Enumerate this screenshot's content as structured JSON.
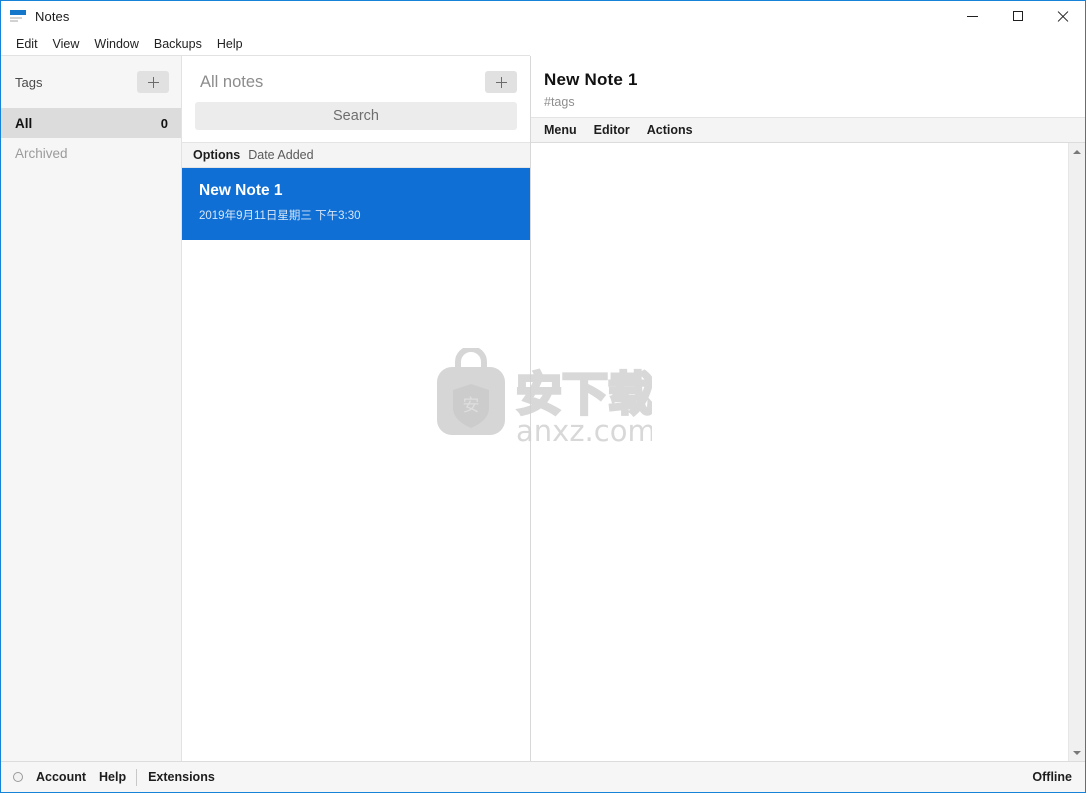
{
  "window": {
    "title": "Notes",
    "icon": "notes-app-icon",
    "controls": {
      "minimize": "minimize-icon",
      "maximize": "maximize-icon",
      "close": "close-icon"
    },
    "accent_color": "#1683d8"
  },
  "menubar": {
    "items": [
      {
        "label": "Edit"
      },
      {
        "label": "View"
      },
      {
        "label": "Window"
      },
      {
        "label": "Backups"
      },
      {
        "label": "Help"
      }
    ]
  },
  "sidebar": {
    "header_label": "Tags",
    "add_tag_icon": "plus-icon",
    "items": [
      {
        "label": "All",
        "count": "0",
        "selected": true
      },
      {
        "label": "Archived",
        "count": "",
        "selected": false
      }
    ]
  },
  "notelist": {
    "title": "All notes",
    "add_note_icon": "plus-icon",
    "search": {
      "placeholder": "Search",
      "value": ""
    },
    "options_label": "Options",
    "sort_label": "Date Added",
    "notes": [
      {
        "title": "New Note 1",
        "date": "2019年9月11日星期三 下午3:30",
        "selected": true
      }
    ]
  },
  "editor": {
    "note_title": "New Note 1",
    "tags_placeholder": "#tags",
    "toolbar": [
      {
        "label": "Menu"
      },
      {
        "label": "Editor"
      },
      {
        "label": "Actions"
      }
    ],
    "content": "",
    "scrollbar": {
      "up_icon": "triangle-up-icon",
      "down_icon": "triangle-down-icon"
    }
  },
  "watermark": {
    "logo_text": "安",
    "chinese_text": "安下载",
    "site": "anxz.com"
  },
  "statusbar": {
    "status_indicator": "circle-icon",
    "account_label": "Account",
    "help_label": "Help",
    "extensions_label": "Extensions",
    "connection_status": "Offline"
  }
}
